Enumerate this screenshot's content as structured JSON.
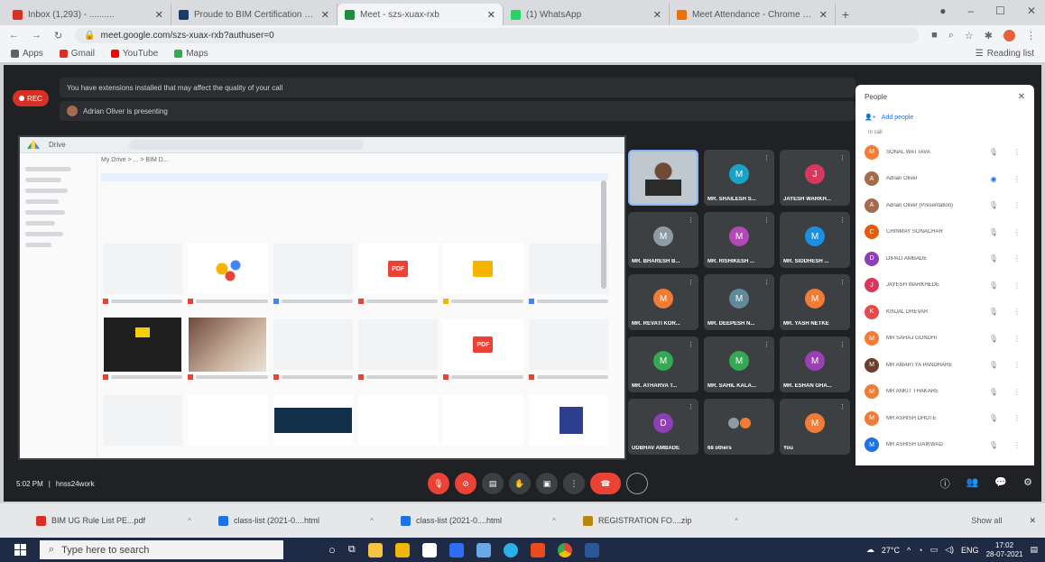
{
  "browser": {
    "tabs": [
      {
        "title": "Inbox (1,293) - ..........",
        "color": "#d93025",
        "active": false
      },
      {
        "title": "Proude to BIM Certification Co...",
        "color": "#1a3b66",
        "active": false
      },
      {
        "title": "Meet - szs-xuax-rxb",
        "color": "#1e8e3e",
        "active": true
      },
      {
        "title": "(1) WhatsApp",
        "color": "#25d366",
        "active": false
      },
      {
        "title": "Meet Attendance - Chrome Wel...",
        "color": "#e8710a",
        "active": false
      }
    ],
    "url": "meet.google.com/szs-xuax-rxb?authuser=0",
    "bookmarks": [
      {
        "label": "Apps",
        "color": "#5f6368"
      },
      {
        "label": "Gmail",
        "color": "#d93025"
      },
      {
        "label": "YouTube",
        "color": "#ff0000"
      },
      {
        "label": "Maps",
        "color": "#34a853"
      }
    ],
    "reading_list": "Reading list"
  },
  "meet": {
    "rec_label": "REC",
    "banner": "You have extensions installed that may affect the quality of your call",
    "presenting": "Adrian Oliver is presenting",
    "time": "5:02 PM",
    "meeting_code": "hnss24work",
    "shared_screen": {
      "app_name": "Drive",
      "path": "My Drive > ... > BIM D..."
    },
    "tiles": [
      {
        "name": "",
        "initial": "",
        "color": "",
        "video": true
      },
      {
        "name": "MR. SHAILESH S...",
        "initial": "M",
        "color": "#1aa3c9"
      },
      {
        "name": "JAYESH WARKH...",
        "initial": "J",
        "color": "#d9385e"
      },
      {
        "name": "MR. BHARESH B...",
        "initial": "M",
        "color": "#8e9ba5"
      },
      {
        "name": "MR. RISHIKESH ...",
        "initial": "M",
        "color": "#b548b8"
      },
      {
        "name": "MR. SIDDHESH ...",
        "initial": "M",
        "color": "#1a8fe3"
      },
      {
        "name": "MR. REVATI KOR...",
        "initial": "M",
        "color": "#f27b35"
      },
      {
        "name": "MR. DEEPESH N...",
        "initial": "M",
        "color": "#5f8a9b"
      },
      {
        "name": "MR. YASH NETKE",
        "initial": "M",
        "color": "#f27b35"
      },
      {
        "name": "MR. ATHARVA T...",
        "initial": "M",
        "color": "#34a853"
      },
      {
        "name": "MR. SAHIL KALA...",
        "initial": "M",
        "color": "#34a853"
      },
      {
        "name": "MR. ESHAN GHA...",
        "initial": "M",
        "color": "#9b3fb5"
      },
      {
        "name": "UDBHAV AMBADE",
        "initial": "D",
        "color": "#8e3fb5"
      },
      {
        "name": "68 others",
        "initial": "",
        "color": "",
        "multi": true
      },
      {
        "name": "You",
        "initial": "M",
        "color": "#f27b35"
      }
    ],
    "people_panel": {
      "title": "People",
      "add_people": "Add people",
      "section": "In call",
      "participants": [
        {
          "name": "SONAL WATTAVA",
          "initial": "M",
          "color": "#f27b35"
        },
        {
          "name": "Adrian Oliver",
          "initial": "A",
          "color": "#a56b4d"
        },
        {
          "name": "Adrian Oliver (Presentation)",
          "initial": "A",
          "color": "#a56b4d"
        },
        {
          "name": "CHINMAY SONACHAR",
          "initial": "C",
          "color": "#e8590c"
        },
        {
          "name": "DIPALI AMBADE",
          "initial": "D",
          "color": "#8e3fb5"
        },
        {
          "name": "JAYESH WARKHEDE",
          "initial": "J",
          "color": "#d9385e"
        },
        {
          "name": "KINJAL DHEVAR",
          "initial": "K",
          "color": "#e84a4a"
        },
        {
          "name": "MR SAHAJ GONDHI",
          "initial": "M",
          "color": "#f27b35"
        },
        {
          "name": "MR AMARTYA PANDHARE",
          "initial": "M",
          "color": "#6d3d2b"
        },
        {
          "name": "MR ANKIT THAKARE",
          "initial": "M",
          "color": "#f27b35"
        },
        {
          "name": "MR ASHISH DHOTE",
          "initial": "M",
          "color": "#f27b35"
        },
        {
          "name": "MR ASHISH GAIKWAD",
          "initial": "M",
          "color": "#1a73e8"
        }
      ]
    }
  },
  "downloads": {
    "items": [
      {
        "label": "BIM UG Rule List PE...pdf",
        "color": "#d93025"
      },
      {
        "label": "class-list (2021-0....html",
        "color": "#1a73e8"
      },
      {
        "label": "class-list (2021-0....html",
        "color": "#1a73e8"
      },
      {
        "label": "REGISTRATION FO....zip",
        "color": "#b8860b"
      }
    ],
    "show_all": "Show all"
  },
  "taskbar": {
    "search_placeholder": "Type here to search",
    "weather": "27°C",
    "lang": "ENG",
    "time": "17:02",
    "date": "28-07-2021"
  }
}
